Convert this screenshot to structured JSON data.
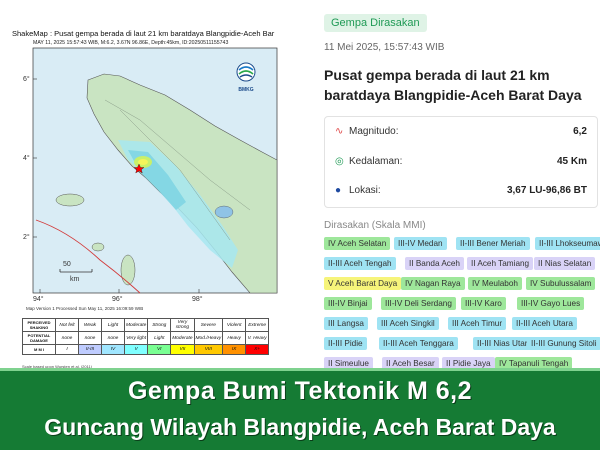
{
  "map": {
    "title_line1": "ShakeMap : Pusat gempa berada di laut 21 km baratdaya Blangpidie-Aceh Bar",
    "title_line2": "MAY 11, 2025 15:57:43 WIB, M:6.2, 3.67N 96.86E, Depth:45km, ID:20250511155743",
    "lat_labels": [
      "6°",
      "4°",
      "2°"
    ],
    "lon_labels": [
      "94°",
      "96°",
      "98°"
    ],
    "scale_value": "50",
    "scale_unit": "km",
    "agency": "BMKG",
    "note": "Map Version 1 Processed Sun May 11, 2025 16:09:59 WIB",
    "scale_footnote": "Scale based upon Wursten et al. (2011)",
    "mmi_table": {
      "row_labels": [
        "PERCEIVED SHAKING",
        "POTENTIAL DAMAGE",
        "M M I"
      ],
      "shaking": [
        "Not felt",
        "Weak",
        "Light",
        "Moderate",
        "Strong",
        "Very strong",
        "Severe",
        "Violent",
        "Extreme"
      ],
      "damage": [
        "none",
        "none",
        "none",
        "Very light",
        "Light",
        "Moderate",
        "Mod./Heavy",
        "Heavy",
        "V. Heavy"
      ],
      "mmi": [
        "I",
        "II-III",
        "IV",
        "V",
        "VI",
        "VII",
        "VIII",
        "IX",
        "X+"
      ],
      "colors": [
        "#ffffff",
        "#bfccff",
        "#a0e6ff",
        "#80ffff",
        "#7aff93",
        "#ffff00",
        "#ffc800",
        "#ff9100",
        "#ff0000"
      ]
    }
  },
  "info": {
    "badge": "Gempa Dirasakan",
    "datetime": "11 Mei 2025, 15:57:43 WIB",
    "headline": "Pusat gempa berada di laut 21 km baratdaya Blangpidie-Aceh Barat Daya",
    "stats": [
      {
        "icon": "magnitude-icon",
        "label": "Magnitudo:",
        "value": "6,2",
        "color": "#e04a4a"
      },
      {
        "icon": "depth-icon",
        "label": "Kedalaman:",
        "value": "45 Km",
        "color": "#1f9a55"
      },
      {
        "icon": "location-icon",
        "label": "Lokasi:",
        "value": "3,67 LU-96,86 BT",
        "color": "#1f4aa0"
      }
    ],
    "felt_label": "Dirasakan (Skala MMI)",
    "felt": [
      [
        "IV Aceh Selatan",
        "III-IV Medan",
        "II-III Bener Meriah",
        "II-III Lhokseumawe"
      ],
      [
        "II-III Aceh Tengah",
        "II Banda Aceh",
        "II Aceh Tamiang",
        "II Nias Selatan"
      ],
      [
        "V Aceh Barat Daya",
        "IV Nagan Raya",
        "IV Meulaboh",
        "IV Subulussalam"
      ],
      [
        "III-IV Binjai",
        "III-IV Deli Serdang",
        "III-IV Karo",
        "III-IV Gayo Lues"
      ],
      [
        "III Langsa",
        "III Aceh Singkil",
        "III Aceh Timur",
        "II-III Aceh Utara"
      ],
      [
        "II-III Pidie",
        "II-III Aceh Tenggara",
        "II-III Nias Utara",
        "II-III Gunung Sitoli"
      ],
      [
        "II Simeulue",
        "II Aceh Besar",
        "II Pidie Jaya",
        "IV Tapanuli Tengah"
      ]
    ]
  },
  "banner": {
    "line1": "Gempa Bumi Tektonik M 6,2",
    "line2": "Guncang Wilayah Blangpidie, Aceh Barat Daya"
  }
}
